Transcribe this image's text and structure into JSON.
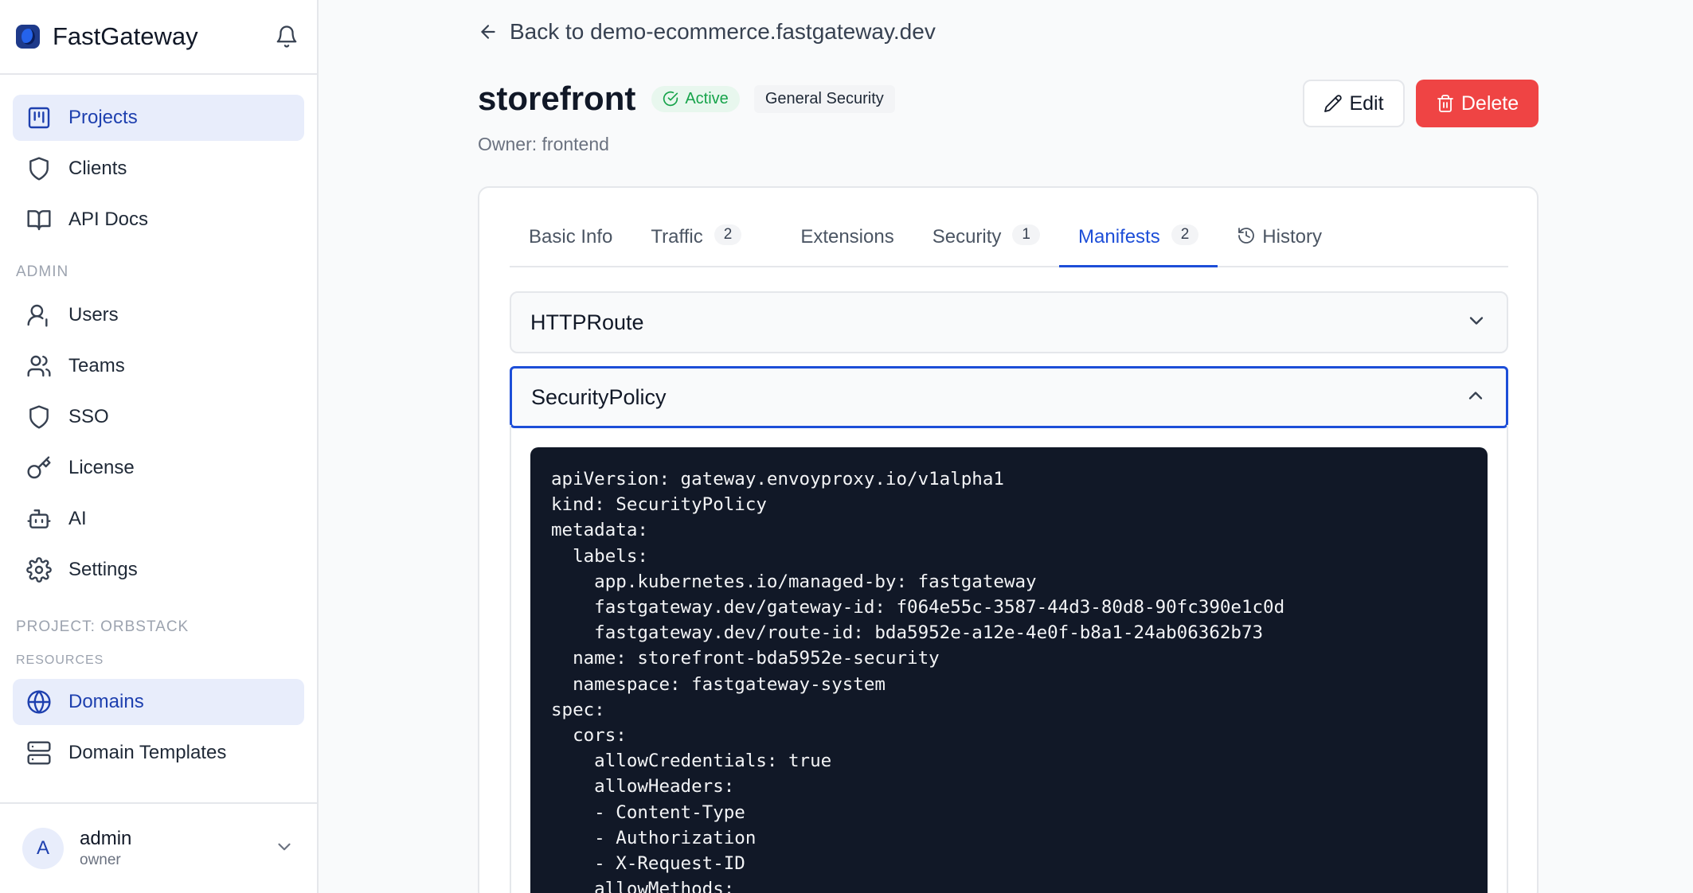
{
  "app": {
    "name": "FastGateway"
  },
  "sidebar": {
    "items": [
      {
        "label": "Projects",
        "icon": "projects-icon",
        "active": true
      },
      {
        "label": "Clients",
        "icon": "shield-icon"
      },
      {
        "label": "API Docs",
        "icon": "book-icon"
      }
    ],
    "admin_label": "ADMIN",
    "admin_items": [
      {
        "label": "Users",
        "icon": "user-icon"
      },
      {
        "label": "Teams",
        "icon": "users-icon"
      },
      {
        "label": "SSO",
        "icon": "shield-icon"
      },
      {
        "label": "License",
        "icon": "key-icon"
      },
      {
        "label": "AI",
        "icon": "bot-icon"
      },
      {
        "label": "Settings",
        "icon": "gear-icon"
      }
    ],
    "project_label": "PROJECT: ORBSTACK",
    "resources_label": "RESOURCES",
    "resource_items": [
      {
        "label": "Domains",
        "icon": "globe-icon",
        "active": true
      },
      {
        "label": "Domain Templates",
        "icon": "server-icon"
      }
    ],
    "user": {
      "initial": "A",
      "name": "admin",
      "role": "owner"
    }
  },
  "header": {
    "back_label": "Back to demo-ecommerce.fastgateway.dev",
    "title": "storefront",
    "status": "Active",
    "plan": "General Security",
    "owner": "Owner: frontend",
    "edit_label": "Edit",
    "delete_label": "Delete"
  },
  "tabs": [
    {
      "label": "Basic Info"
    },
    {
      "label": "Traffic",
      "count": "2"
    },
    {
      "label": "Extensions"
    },
    {
      "label": "Security",
      "count": "1"
    },
    {
      "label": "Manifests",
      "count": "2",
      "active": true
    },
    {
      "label": "History",
      "icon": "history-icon"
    }
  ],
  "manifests": {
    "sections": [
      {
        "title": "HTTPRoute",
        "expanded": false
      },
      {
        "title": "SecurityPolicy",
        "expanded": true
      }
    ],
    "code": "apiVersion: gateway.envoyproxy.io/v1alpha1\nkind: SecurityPolicy\nmetadata:\n  labels:\n    app.kubernetes.io/managed-by: fastgateway\n    fastgateway.dev/gateway-id: f064e55c-3587-44d3-80d8-90fc390e1c0d\n    fastgateway.dev/route-id: bda5952e-a12e-4e0f-b8a1-24ab06362b73\n  name: storefront-bda5952e-security\n  namespace: fastgateway-system\nspec:\n  cors:\n    allowCredentials: true\n    allowHeaders:\n    - Content-Type\n    - Authorization\n    - X-Request-ID\n    allowMethods:"
  },
  "colors": {
    "accent": "#1d4ed8",
    "danger": "#ef4444",
    "success": "#16a34a",
    "code_bg": "#111827"
  }
}
